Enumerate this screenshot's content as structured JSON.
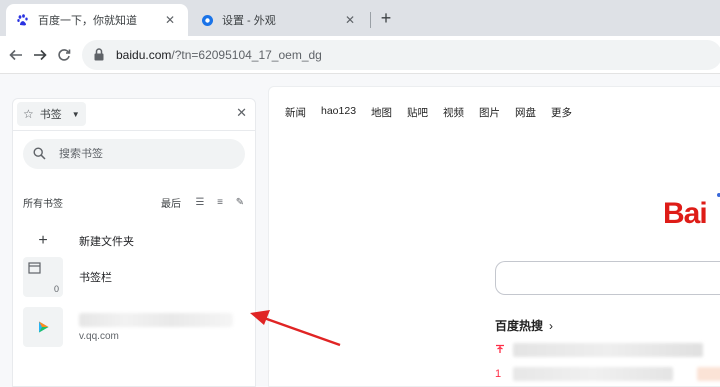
{
  "tabs": [
    {
      "title": "百度一下，你就知道",
      "favicon": "baidu-paw-icon",
      "active": true
    },
    {
      "title": "设置 - 外观",
      "favicon": "chrome-settings-gear-icon",
      "active": false
    }
  ],
  "toolbar": {
    "url_host": "baidu.com",
    "url_path": "/?tn=62095104_17_oem_dg"
  },
  "bookmarks_panel": {
    "selector_label": "书签",
    "search_placeholder": "搜索书签",
    "section_title": "所有书签",
    "sort_label": "最后",
    "items": [
      {
        "label": "新建文件夹",
        "icon": "plus-icon"
      },
      {
        "label": "书签栏",
        "icon": "folder-window-icon",
        "count": "0"
      },
      {
        "label": "",
        "sublabel": "v.qq.com",
        "icon": "tencent-video-play-icon"
      }
    ]
  },
  "baidu_page": {
    "nav": [
      "新闻",
      "hao123",
      "地图",
      "贴吧",
      "视频",
      "图片",
      "网盘",
      "更多"
    ],
    "logo_text": "Bai",
    "hot_title": "百度热搜",
    "hot_ranks": [
      "",
      "1"
    ]
  },
  "colors": {
    "baidu_red": "#de1c17",
    "hot_rank_red": "#fe2d46",
    "annotation_arrow": "#e02424"
  }
}
